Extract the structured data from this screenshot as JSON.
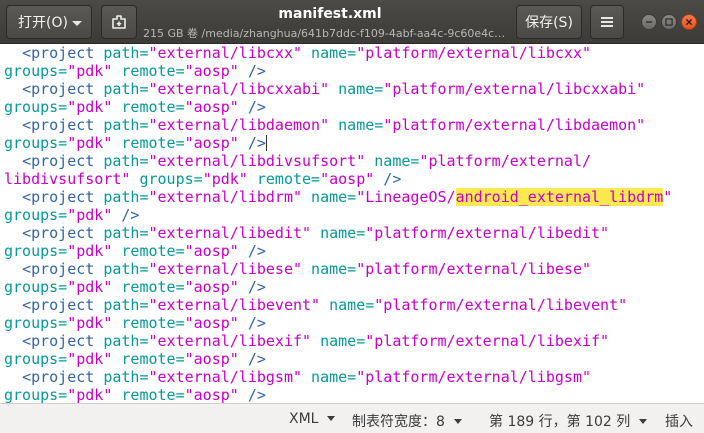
{
  "header": {
    "open_label": "打开(O)",
    "title": "manifest.xml",
    "subtitle": "215 GB 卷 /media/zhanghua/641b7ddc-f109-4abf-aa4c-9c60e4c…",
    "save_label": "保存(S)"
  },
  "editor": {
    "lines": [
      [
        {
          "t": "  ",
          "c": "tx"
        },
        {
          "t": "<project",
          "c": "el"
        },
        {
          "t": " path=",
          "c": "at"
        },
        {
          "t": "\"external/libcxx\"",
          "c": "vl"
        },
        {
          "t": " name=",
          "c": "at"
        },
        {
          "t": "\"platform/external/libcxx\"",
          "c": "vl"
        }
      ],
      [
        {
          "t": "groups=",
          "c": "at"
        },
        {
          "t": "\"pdk\"",
          "c": "vl"
        },
        {
          "t": " remote=",
          "c": "at"
        },
        {
          "t": "\"aosp\"",
          "c": "vl"
        },
        {
          "t": " />",
          "c": "el"
        }
      ],
      [
        {
          "t": "  ",
          "c": "tx"
        },
        {
          "t": "<project",
          "c": "el"
        },
        {
          "t": " path=",
          "c": "at"
        },
        {
          "t": "\"external/libcxxabi\"",
          "c": "vl"
        },
        {
          "t": " name=",
          "c": "at"
        },
        {
          "t": "\"platform/external/libcxxabi\"",
          "c": "vl"
        }
      ],
      [
        {
          "t": "groups=",
          "c": "at"
        },
        {
          "t": "\"pdk\"",
          "c": "vl"
        },
        {
          "t": " remote=",
          "c": "at"
        },
        {
          "t": "\"aosp\"",
          "c": "vl"
        },
        {
          "t": " />",
          "c": "el"
        }
      ],
      [
        {
          "t": "  ",
          "c": "tx"
        },
        {
          "t": "<project",
          "c": "el"
        },
        {
          "t": " path=",
          "c": "at"
        },
        {
          "t": "\"external/libdaemon\"",
          "c": "vl"
        },
        {
          "t": " name=",
          "c": "at"
        },
        {
          "t": "\"platform/external/libdaemon\"",
          "c": "vl"
        }
      ],
      [
        {
          "t": "groups=",
          "c": "at"
        },
        {
          "t": "\"pdk\"",
          "c": "vl"
        },
        {
          "t": " remote=",
          "c": "at"
        },
        {
          "t": "\"aosp\"",
          "c": "vl"
        },
        {
          "t": " />",
          "c": "el"
        },
        {
          "cursor": true
        }
      ],
      [
        {
          "t": "  ",
          "c": "tx"
        },
        {
          "t": "<project",
          "c": "el"
        },
        {
          "t": " path=",
          "c": "at"
        },
        {
          "t": "\"external/libdivsufsort\"",
          "c": "vl"
        },
        {
          "t": " name=",
          "c": "at"
        },
        {
          "t": "\"platform/external/",
          "c": "vl"
        }
      ],
      [
        {
          "t": "libdivsufsort\"",
          "c": "vl"
        },
        {
          "t": " groups=",
          "c": "at"
        },
        {
          "t": "\"pdk\"",
          "c": "vl"
        },
        {
          "t": " remote=",
          "c": "at"
        },
        {
          "t": "\"aosp\"",
          "c": "vl"
        },
        {
          "t": " />",
          "c": "el"
        }
      ],
      [
        {
          "t": "  ",
          "c": "tx"
        },
        {
          "t": "<project",
          "c": "el"
        },
        {
          "t": " path=",
          "c": "at"
        },
        {
          "t": "\"external/libdrm\"",
          "c": "vl"
        },
        {
          "t": " name=",
          "c": "at"
        },
        {
          "t": "\"LineageOS/",
          "c": "vl"
        },
        {
          "t": "android_external_libdrm",
          "c": "vl",
          "hl": true
        },
        {
          "t": "\"",
          "c": "vl"
        }
      ],
      [
        {
          "t": "groups=",
          "c": "at"
        },
        {
          "t": "\"pdk\"",
          "c": "vl"
        },
        {
          "t": " />",
          "c": "el"
        }
      ],
      [
        {
          "t": "  ",
          "c": "tx"
        },
        {
          "t": "<project",
          "c": "el"
        },
        {
          "t": " path=",
          "c": "at"
        },
        {
          "t": "\"external/libedit\"",
          "c": "vl"
        },
        {
          "t": " name=",
          "c": "at"
        },
        {
          "t": "\"platform/external/libedit\"",
          "c": "vl"
        }
      ],
      [
        {
          "t": "groups=",
          "c": "at"
        },
        {
          "t": "\"pdk\"",
          "c": "vl"
        },
        {
          "t": " remote=",
          "c": "at"
        },
        {
          "t": "\"aosp\"",
          "c": "vl"
        },
        {
          "t": " />",
          "c": "el"
        }
      ],
      [
        {
          "t": "  ",
          "c": "tx"
        },
        {
          "t": "<project",
          "c": "el"
        },
        {
          "t": " path=",
          "c": "at"
        },
        {
          "t": "\"external/libese\"",
          "c": "vl"
        },
        {
          "t": " name=",
          "c": "at"
        },
        {
          "t": "\"platform/external/libese\"",
          "c": "vl"
        }
      ],
      [
        {
          "t": "groups=",
          "c": "at"
        },
        {
          "t": "\"pdk\"",
          "c": "vl"
        },
        {
          "t": " remote=",
          "c": "at"
        },
        {
          "t": "\"aosp\"",
          "c": "vl"
        },
        {
          "t": " />",
          "c": "el"
        }
      ],
      [
        {
          "t": "  ",
          "c": "tx"
        },
        {
          "t": "<project",
          "c": "el"
        },
        {
          "t": " path=",
          "c": "at"
        },
        {
          "t": "\"external/libevent\"",
          "c": "vl"
        },
        {
          "t": " name=",
          "c": "at"
        },
        {
          "t": "\"platform/external/libevent\"",
          "c": "vl"
        }
      ],
      [
        {
          "t": "groups=",
          "c": "at"
        },
        {
          "t": "\"pdk\"",
          "c": "vl"
        },
        {
          "t": " remote=",
          "c": "at"
        },
        {
          "t": "\"aosp\"",
          "c": "vl"
        },
        {
          "t": " />",
          "c": "el"
        }
      ],
      [
        {
          "t": "  ",
          "c": "tx"
        },
        {
          "t": "<project",
          "c": "el"
        },
        {
          "t": " path=",
          "c": "at"
        },
        {
          "t": "\"external/libexif\"",
          "c": "vl"
        },
        {
          "t": " name=",
          "c": "at"
        },
        {
          "t": "\"platform/external/libexif\"",
          "c": "vl"
        }
      ],
      [
        {
          "t": "groups=",
          "c": "at"
        },
        {
          "t": "\"pdk\"",
          "c": "vl"
        },
        {
          "t": " remote=",
          "c": "at"
        },
        {
          "t": "\"aosp\"",
          "c": "vl"
        },
        {
          "t": " />",
          "c": "el"
        }
      ],
      [
        {
          "t": "  ",
          "c": "tx"
        },
        {
          "t": "<project",
          "c": "el"
        },
        {
          "t": " path=",
          "c": "at"
        },
        {
          "t": "\"external/libgsm\"",
          "c": "vl"
        },
        {
          "t": " name=",
          "c": "at"
        },
        {
          "t": "\"platform/external/libgsm\"",
          "c": "vl"
        }
      ],
      [
        {
          "t": "groups=",
          "c": "at"
        },
        {
          "t": "\"pdk\"",
          "c": "vl"
        },
        {
          "t": " remote=",
          "c": "at"
        },
        {
          "t": "\"aosp\"",
          "c": "vl"
        },
        {
          "t": " />",
          "c": "el"
        }
      ]
    ]
  },
  "statusbar": {
    "language": "XML",
    "tab_width": "制表符宽度：8",
    "position": "第 189 行，第 102 列",
    "insert_mode": "插入"
  },
  "colors": {
    "header_bg": "#3c3b37",
    "close_button": "#e95420",
    "tag": "#3465a4",
    "attribute": "#06989a",
    "value": "#c800c8",
    "search_highlight": "#fce94f"
  },
  "icons": {
    "new_tab": "new-tab-icon",
    "menu": "hamburger-menu-icon",
    "minimize": "minimize-icon",
    "maximize": "maximize-icon",
    "close": "close-icon"
  }
}
